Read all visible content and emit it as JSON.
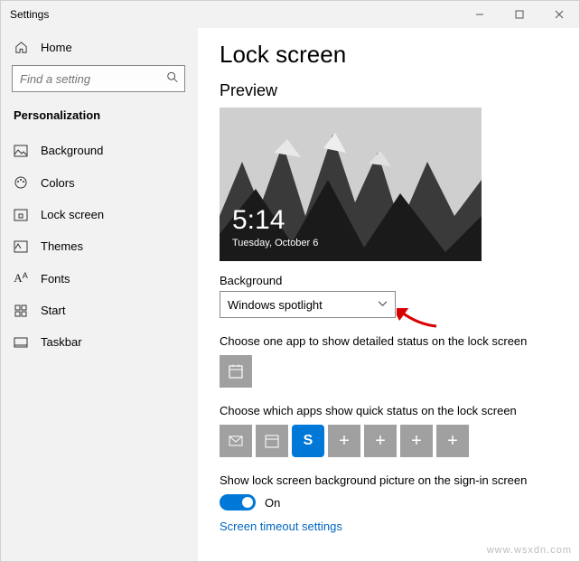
{
  "window": {
    "title": "Settings"
  },
  "sidebar": {
    "home": "Home",
    "search_placeholder": "Find a setting",
    "section": "Personalization",
    "items": [
      {
        "label": "Background"
      },
      {
        "label": "Colors"
      },
      {
        "label": "Lock screen"
      },
      {
        "label": "Themes"
      },
      {
        "label": "Fonts"
      },
      {
        "label": "Start"
      },
      {
        "label": "Taskbar"
      }
    ]
  },
  "main": {
    "title": "Lock screen",
    "preview_label": "Preview",
    "preview": {
      "time": "5:14",
      "date": "Tuesday, October 6"
    },
    "background_label": "Background",
    "background_value": "Windows spotlight",
    "detailed_label": "Choose one app to show detailed status on the lock screen",
    "quick_label": "Choose which apps show quick status on the lock screen",
    "signin_label": "Show lock screen background picture on the sign-in screen",
    "toggle_state": "On",
    "link": "Screen timeout settings"
  },
  "watermark": "www.wsxdn.com"
}
